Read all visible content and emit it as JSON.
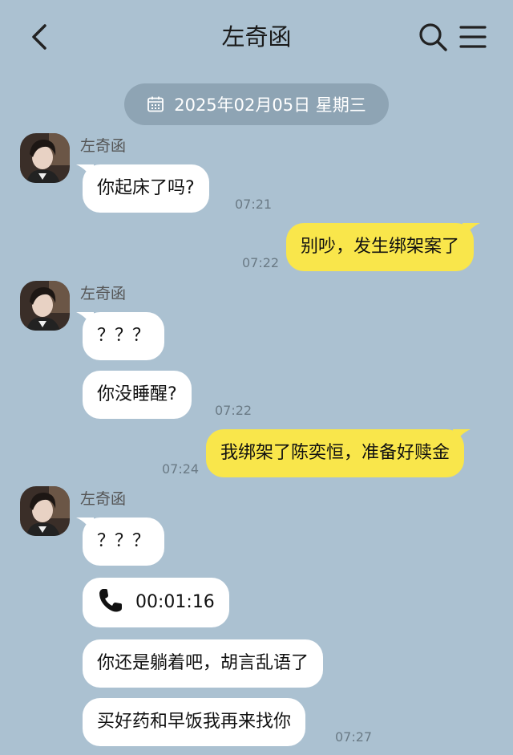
{
  "header": {
    "title": "左奇函",
    "back_icon": "chevron-left-icon",
    "search_icon": "search-icon",
    "menu_icon": "menu-icon"
  },
  "date_divider": {
    "text": "2025年02月05日 星期三",
    "icon": "calendar-icon"
  },
  "colors": {
    "background": "#abc1d1",
    "incoming": "#ffffff",
    "outgoing": "#f9e64b",
    "pill": "#8ea4b4"
  },
  "messages": {
    "sender_name": "左奇函",
    "m1": {
      "text": "你起床了吗?",
      "time": "07:21"
    },
    "m2": {
      "text": "别吵，发生绑架案了",
      "time": "07:22"
    },
    "m3": {
      "text": "？？？"
    },
    "m4": {
      "text": "你没睡醒?",
      "time": "07:22"
    },
    "m5": {
      "text": "我绑架了陈奕恒，准备好赎金",
      "time": "07:24"
    },
    "m6": {
      "text": "？？？"
    },
    "m7": {
      "text": "00:01:16",
      "icon": "phone-icon"
    },
    "m8": {
      "text": "你还是躺着吧，胡言乱语了"
    },
    "m9": {
      "text": "买好药和早饭我再来找你",
      "time": "07:27"
    }
  }
}
